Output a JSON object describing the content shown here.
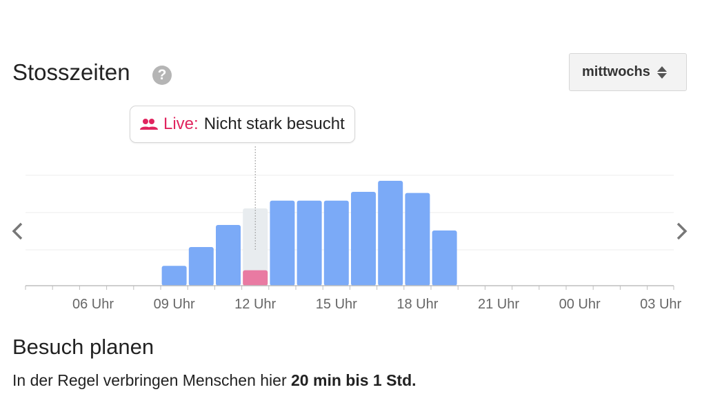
{
  "header": {
    "title": "Stosszeiten",
    "help_icon": "help-icon",
    "day_selector": {
      "value": "mittwochs"
    }
  },
  "live": {
    "label": "Live:",
    "status": "Nicht stark besucht",
    "icon": "people-icon",
    "accent_color": "#e0245e"
  },
  "nav": {
    "prev_icon": "chevron-left-icon",
    "next_icon": "chevron-right-icon"
  },
  "colors": {
    "bar": "#7baaf7",
    "current_hour_bg": "#e8ecef",
    "live_bar": "#e97aa2"
  },
  "chart_data": {
    "type": "bar",
    "title": "",
    "xlabel": "",
    "ylabel": "",
    "hours": [
      4,
      5,
      6,
      7,
      8,
      9,
      10,
      11,
      12,
      13,
      14,
      15,
      16,
      17,
      18,
      19,
      20,
      21,
      22,
      23,
      0,
      1,
      2,
      3
    ],
    "values": [
      0,
      0,
      0,
      0,
      0,
      18,
      35,
      55,
      0,
      77,
      77,
      77,
      85,
      95,
      84,
      50,
      0,
      0,
      0,
      0,
      0,
      0,
      0,
      0
    ],
    "current_hour": 12,
    "current_hour_usual": 70,
    "live_value": 14,
    "ylim": [
      0,
      100
    ],
    "grid": true,
    "tick_labels": [
      {
        "hour": 6,
        "label": "06 Uhr"
      },
      {
        "hour": 9,
        "label": "09 Uhr"
      },
      {
        "hour": 12,
        "label": "12 Uhr"
      },
      {
        "hour": 15,
        "label": "15 Uhr"
      },
      {
        "hour": 18,
        "label": "18 Uhr"
      },
      {
        "hour": 21,
        "label": "21 Uhr"
      },
      {
        "hour": 0,
        "label": "00 Uhr"
      },
      {
        "hour": 3,
        "label": "03 Uhr"
      }
    ]
  },
  "plan": {
    "title": "Besuch planen",
    "text_prefix": "In der Regel verbringen Menschen hier ",
    "text_bold": "20 min bis 1 Std."
  }
}
